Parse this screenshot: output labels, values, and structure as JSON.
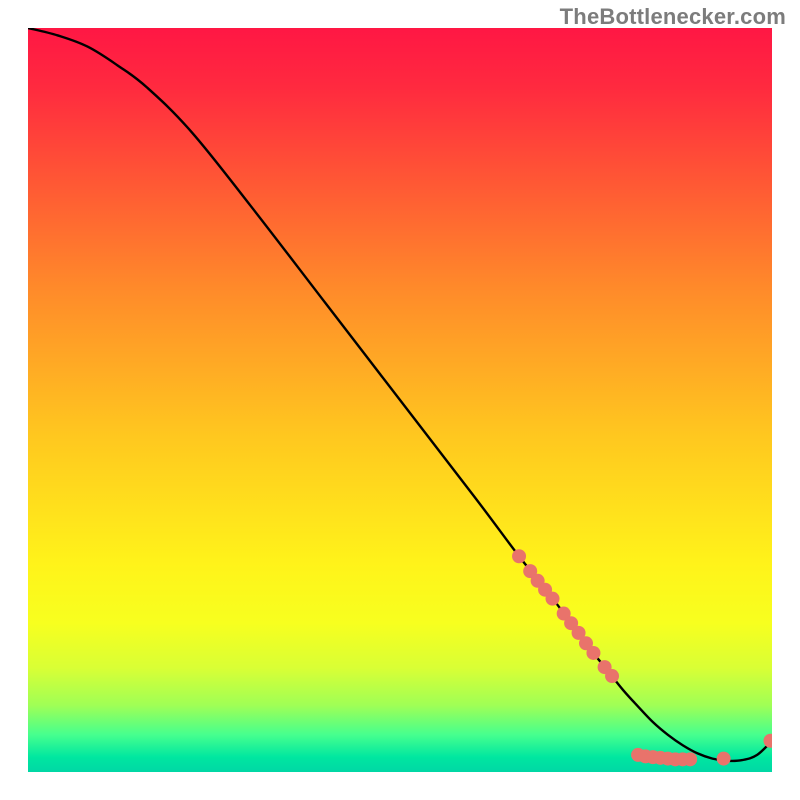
{
  "attribution": "TheBottlenecker.com",
  "chart_data": {
    "type": "line",
    "title": "",
    "xlabel": "",
    "ylabel": "",
    "xlim": [
      0,
      100
    ],
    "ylim": [
      0,
      100
    ],
    "background_gradient": {
      "stops": [
        {
          "offset": 0.0,
          "color": "#ff1744"
        },
        {
          "offset": 0.08,
          "color": "#ff2a3f"
        },
        {
          "offset": 0.2,
          "color": "#ff5535"
        },
        {
          "offset": 0.35,
          "color": "#ff8a2a"
        },
        {
          "offset": 0.55,
          "color": "#ffc81f"
        },
        {
          "offset": 0.72,
          "color": "#fff31a"
        },
        {
          "offset": 0.8,
          "color": "#f7ff1f"
        },
        {
          "offset": 0.86,
          "color": "#d9ff35"
        },
        {
          "offset": 0.91,
          "color": "#a0ff55"
        },
        {
          "offset": 0.95,
          "color": "#46ff8e"
        },
        {
          "offset": 0.98,
          "color": "#00e7a0"
        },
        {
          "offset": 1.0,
          "color": "#00d7a5"
        }
      ]
    },
    "series": [
      {
        "name": "curve",
        "x": [
          0,
          4,
          8,
          12,
          16,
          22,
          30,
          40,
          50,
          60,
          66,
          70,
          73,
          76,
          78,
          80,
          82,
          84,
          86,
          88,
          90,
          92,
          94,
          96,
          98,
          100
        ],
        "y": [
          100,
          99,
          97.5,
          95,
          92,
          86,
          76,
          63,
          50,
          37,
          29,
          24,
          20,
          16,
          13.5,
          11,
          8.8,
          6.7,
          5.0,
          3.6,
          2.5,
          1.8,
          1.5,
          1.6,
          2.3,
          4.2
        ]
      }
    ],
    "markers": [
      {
        "x": 66.0,
        "y": 29.0
      },
      {
        "x": 67.5,
        "y": 27.0
      },
      {
        "x": 68.5,
        "y": 25.7
      },
      {
        "x": 69.5,
        "y": 24.5
      },
      {
        "x": 70.5,
        "y": 23.3
      },
      {
        "x": 72.0,
        "y": 21.3
      },
      {
        "x": 73.0,
        "y": 20.0
      },
      {
        "x": 74.0,
        "y": 18.7
      },
      {
        "x": 75.0,
        "y": 17.3
      },
      {
        "x": 76.0,
        "y": 16.0
      },
      {
        "x": 77.5,
        "y": 14.1
      },
      {
        "x": 78.5,
        "y": 12.9
      },
      {
        "x": 82.0,
        "y": 2.3
      },
      {
        "x": 83.0,
        "y": 2.1
      },
      {
        "x": 84.0,
        "y": 2.0
      },
      {
        "x": 85.0,
        "y": 1.9
      },
      {
        "x": 86.0,
        "y": 1.8
      },
      {
        "x": 87.0,
        "y": 1.7
      },
      {
        "x": 88.0,
        "y": 1.7
      },
      {
        "x": 89.0,
        "y": 1.7
      },
      {
        "x": 93.5,
        "y": 1.8
      },
      {
        "x": 99.8,
        "y": 4.2
      }
    ],
    "marker_style": {
      "radius_px": 7,
      "fill": "#e9736b"
    }
  }
}
